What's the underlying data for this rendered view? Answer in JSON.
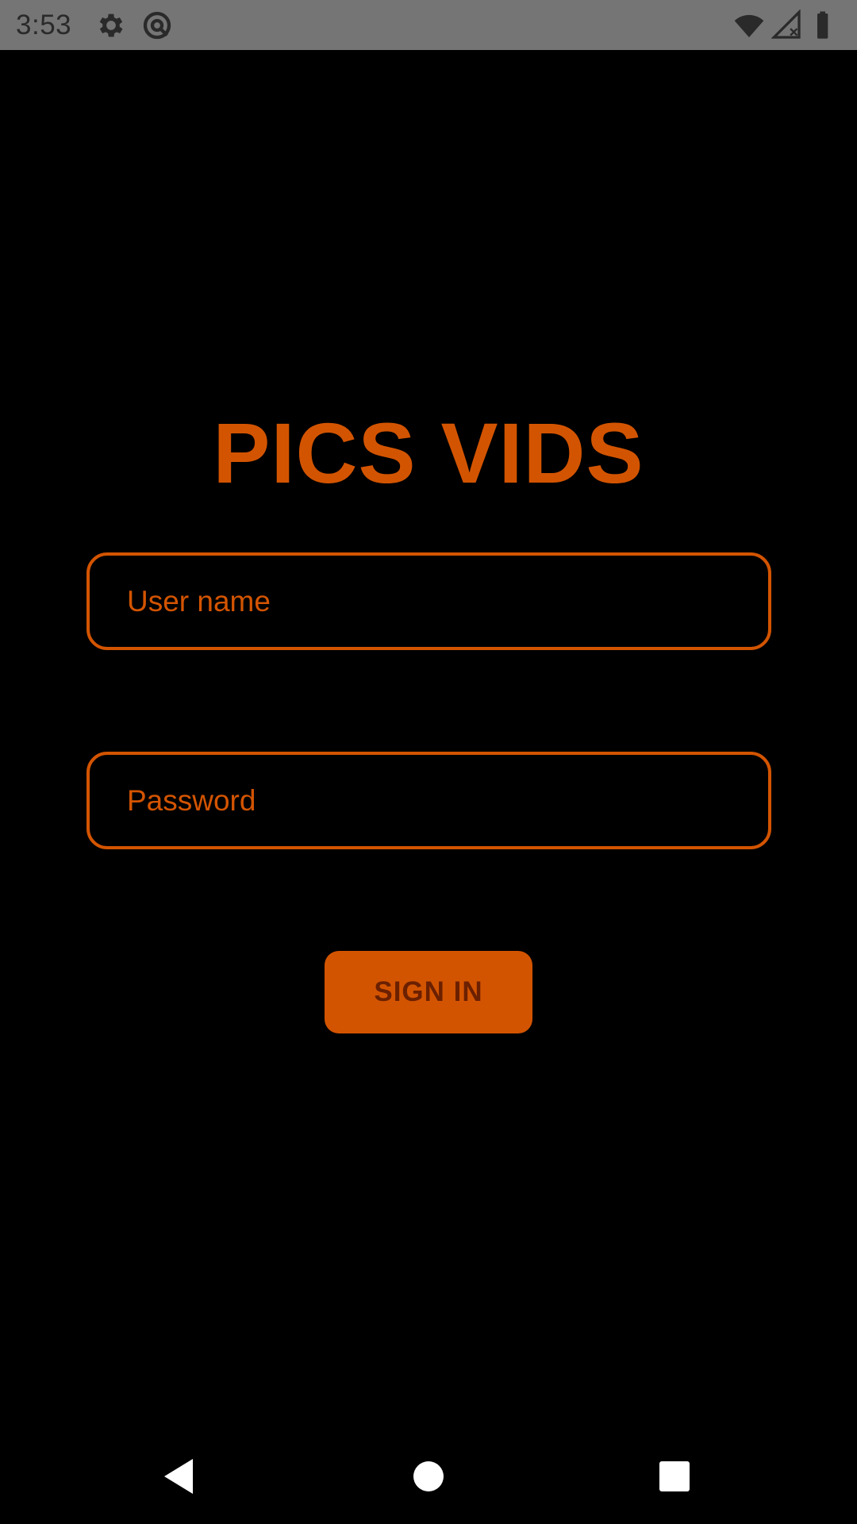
{
  "status_bar": {
    "time": "3:53",
    "left_icons": [
      "settings-gear-icon",
      "at-sign-notification-icon"
    ],
    "right_icons": [
      "wifi-icon",
      "cell-signal-icon",
      "battery-icon"
    ],
    "background": "#757575"
  },
  "app": {
    "title": "PICS VIDS",
    "accent_color": "#d35400",
    "background": "#000000"
  },
  "form": {
    "username": {
      "placeholder": "User name",
      "value": ""
    },
    "password": {
      "placeholder": "Password",
      "value": ""
    },
    "submit_label": "SIGN IN"
  },
  "nav_bar": {
    "buttons": [
      "back-triangle-icon",
      "home-circle-icon",
      "recents-square-icon"
    ]
  }
}
